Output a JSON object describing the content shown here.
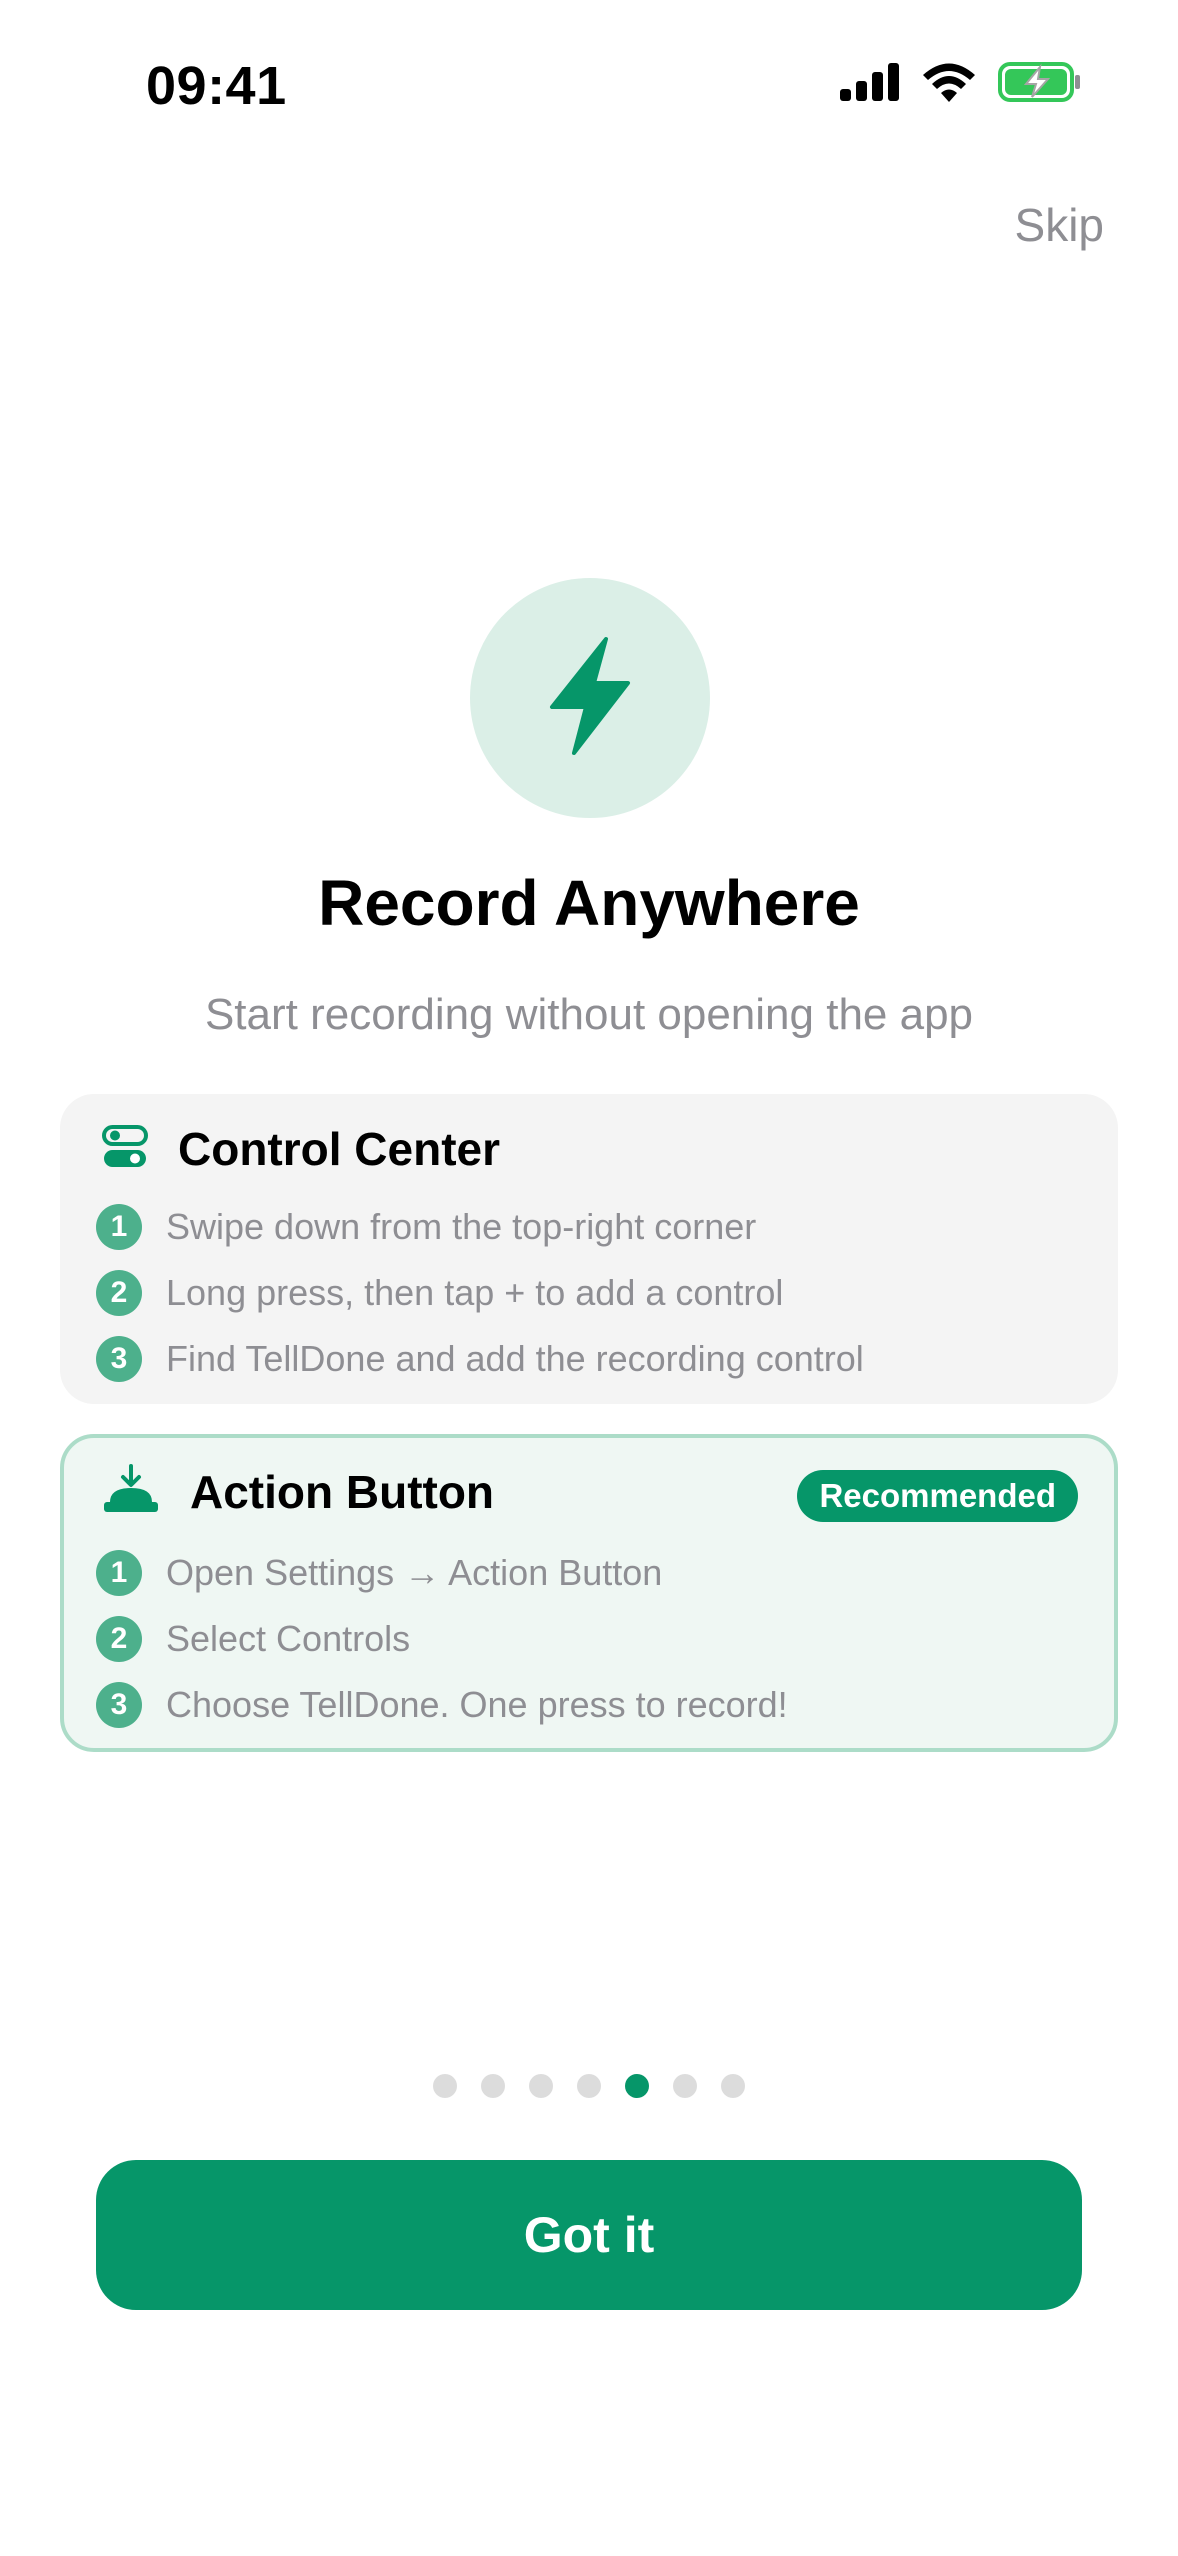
{
  "status_bar": {
    "time": "09:41",
    "icons": [
      "signal-icon",
      "wifi-icon",
      "battery-charging-icon"
    ]
  },
  "header": {
    "skip_label": "Skip"
  },
  "hero": {
    "icon": "lightning-bolt-icon",
    "title": "Record Anywhere",
    "subtitle": "Start recording without opening the app"
  },
  "cards": [
    {
      "icon": "toggle-switches-icon",
      "title": "Control Center",
      "steps": [
        {
          "num": "1",
          "text": "Swipe down from the top-right corner"
        },
        {
          "num": "2",
          "text": "Long press, then tap + to add a control"
        },
        {
          "num": "3",
          "text": "Find TellDone and add the recording control"
        }
      ]
    },
    {
      "icon": "action-button-icon",
      "title": "Action Button",
      "badge": "Recommended",
      "steps": [
        {
          "num": "1",
          "text": "Open Settings → Action Button"
        },
        {
          "num": "2",
          "text": "Select Controls"
        },
        {
          "num": "3",
          "text": "Choose TellDone. One press to record!"
        }
      ]
    }
  ],
  "pagination": {
    "total": 7,
    "current": 5
  },
  "primary_button": {
    "label": "Got it"
  },
  "colors": {
    "accent": "#069669",
    "accent_light": "#DBEFE7",
    "card_gray": "#F4F4F4",
    "card_green": "#EFF7F3",
    "card_green_border": "#ACDCC8",
    "secondary_text": "#8E8E93",
    "battery_green": "#34C759"
  }
}
